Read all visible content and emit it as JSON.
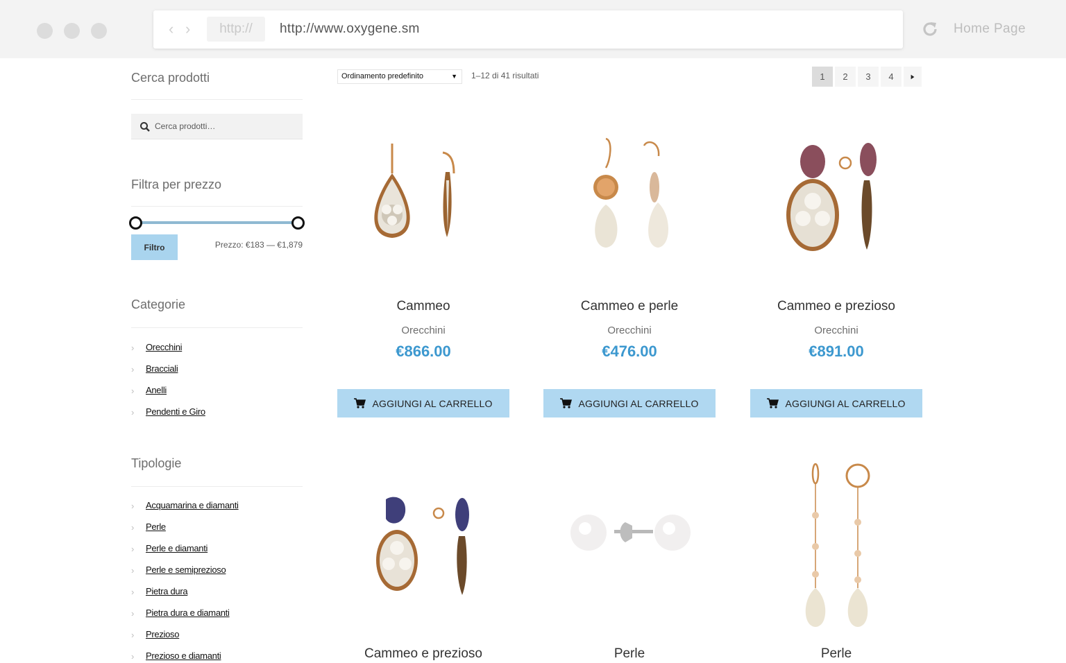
{
  "browser": {
    "protocol": "http://",
    "url": "http://www.oxygene.sm",
    "home_label": "Home Page"
  },
  "sidebar": {
    "search": {
      "title": "Cerca prodotti",
      "placeholder": "Cerca prodotti…"
    },
    "price_filter": {
      "title": "Filtra per prezzo",
      "button": "Filtro",
      "price_label": "Prezzo: €183 — €1,879",
      "min_fraction": 0.0,
      "max_fraction": 1.0
    },
    "categories": {
      "title": "Categorie",
      "items": [
        "Orecchini",
        "Bracciali",
        "Anelli",
        "Pendenti e Giro"
      ]
    },
    "types": {
      "title": "Tipologie",
      "items": [
        "Acquamarina e diamanti",
        "Perle",
        "Perle e diamanti",
        "Perle e semiprezioso",
        "Pietra dura",
        "Pietra dura e diamanti",
        "Prezioso",
        "Prezioso e diamanti"
      ]
    }
  },
  "toolbar": {
    "sort_value": "Ordinamento predefinito",
    "results": "1–12 di 41 risultati",
    "pages": [
      "1",
      "2",
      "3",
      "4"
    ],
    "active_page": "1",
    "next_icon": "arrow-right-icon"
  },
  "products": [
    {
      "title": "Cammeo",
      "category": "Orecchini",
      "price": "€866.00",
      "cart_label": "AGGIUNGI AL CARRELLO"
    },
    {
      "title": "Cammeo e perle",
      "category": "Orecchini",
      "price": "€476.00",
      "cart_label": "AGGIUNGI AL CARRELLO"
    },
    {
      "title": "Cammeo e prezioso",
      "category": "Orecchini",
      "price": "€891.00",
      "cart_label": "AGGIUNGI AL CARRELLO"
    },
    {
      "title": "Cammeo e prezioso"
    },
    {
      "title": "Perle"
    },
    {
      "title": "Perle"
    }
  ],
  "colors": {
    "accent_price": "#3c98cf",
    "button_bg": "#b0d8f1",
    "filter_bg": "#a9d4ee"
  }
}
